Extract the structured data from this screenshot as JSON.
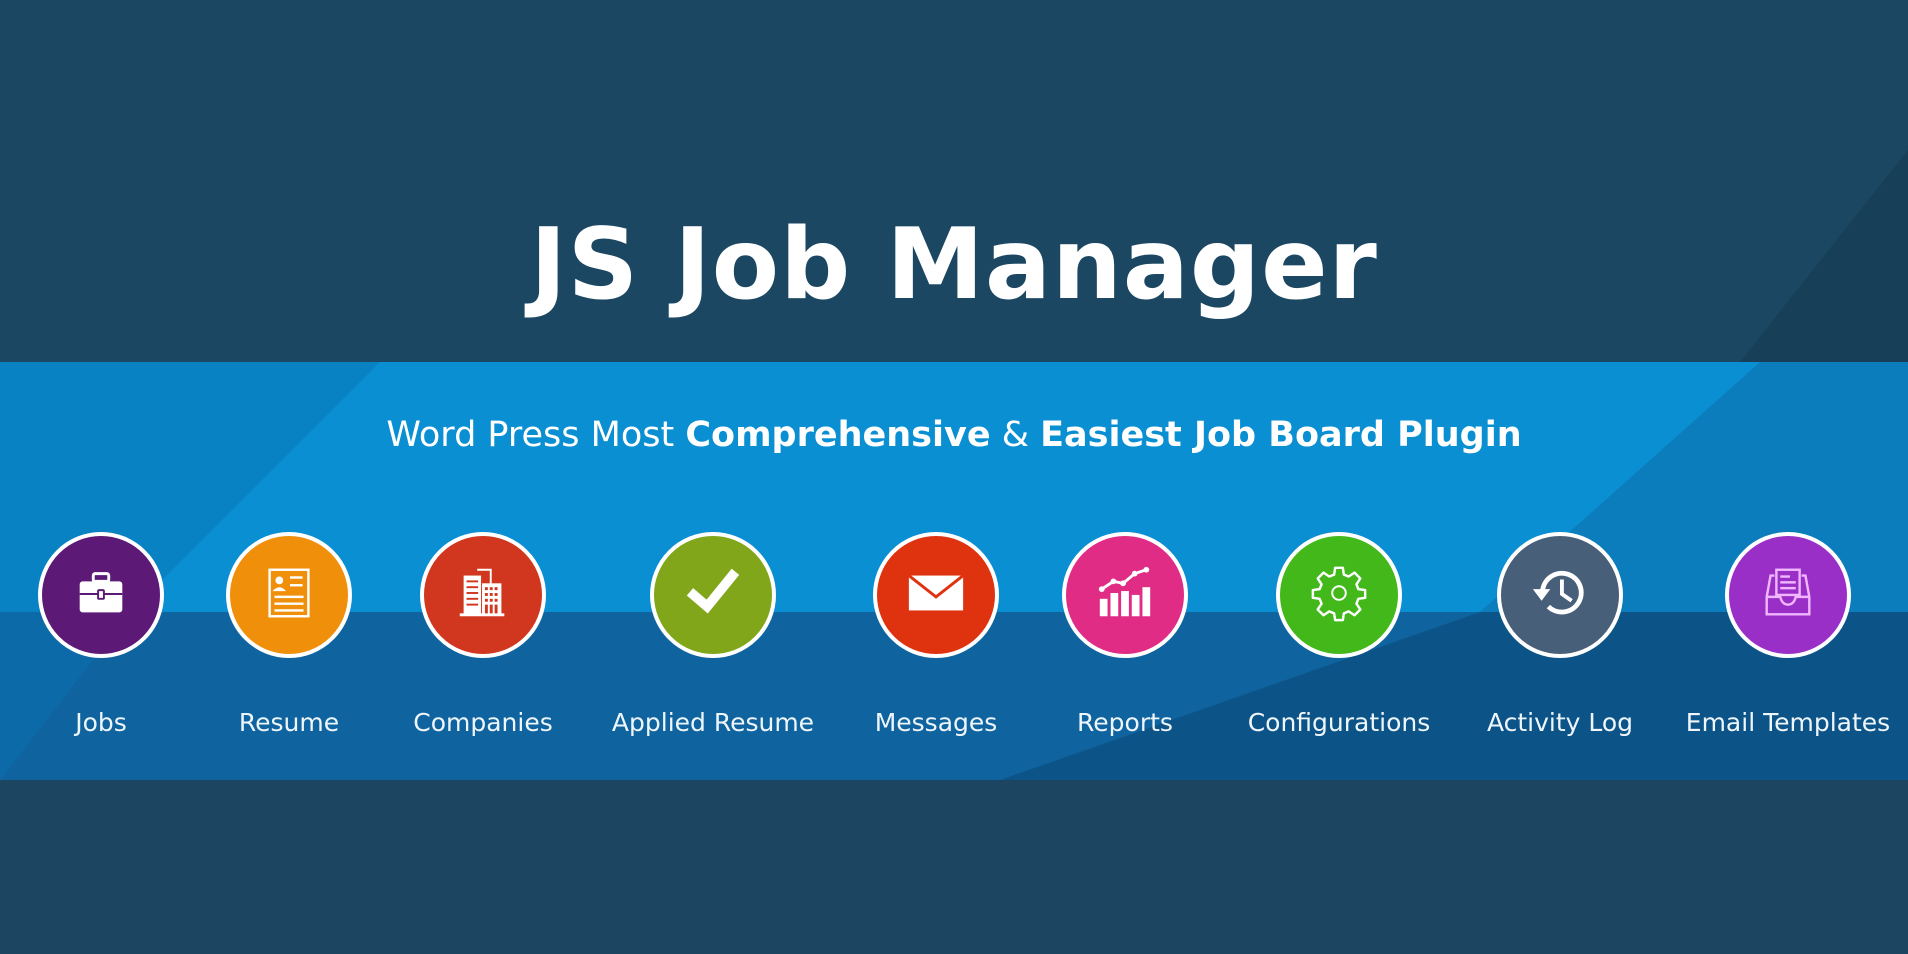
{
  "banner": {
    "title": "JS Job Manager",
    "tagline": {
      "part1": "Word Press Most ",
      "part2": "Comprehensive",
      "part3": " & ",
      "part4": "Easiest Job Board Plugin"
    }
  },
  "features": [
    {
      "label": "Jobs",
      "icon": "briefcase-icon",
      "color": "#5c1a76"
    },
    {
      "label": "Resume",
      "icon": "resume-icon",
      "color": "#ef8f0a"
    },
    {
      "label": "Companies",
      "icon": "building-icon",
      "color": "#d1361e"
    },
    {
      "label": "Applied Resume",
      "icon": "checkmark-icon",
      "color": "#82a61a"
    },
    {
      "label": "Messages",
      "icon": "envelope-icon",
      "color": "#df3310"
    },
    {
      "label": "Reports",
      "icon": "chart-icon",
      "color": "#e02c84"
    },
    {
      "label": "Configurations",
      "icon": "gear-icon",
      "color": "#43b81a"
    },
    {
      "label": "Activity Log",
      "icon": "history-icon",
      "color": "#485f79"
    },
    {
      "label": "Email Templates",
      "icon": "inbox-icon",
      "color": "#9a2fc7"
    }
  ]
}
